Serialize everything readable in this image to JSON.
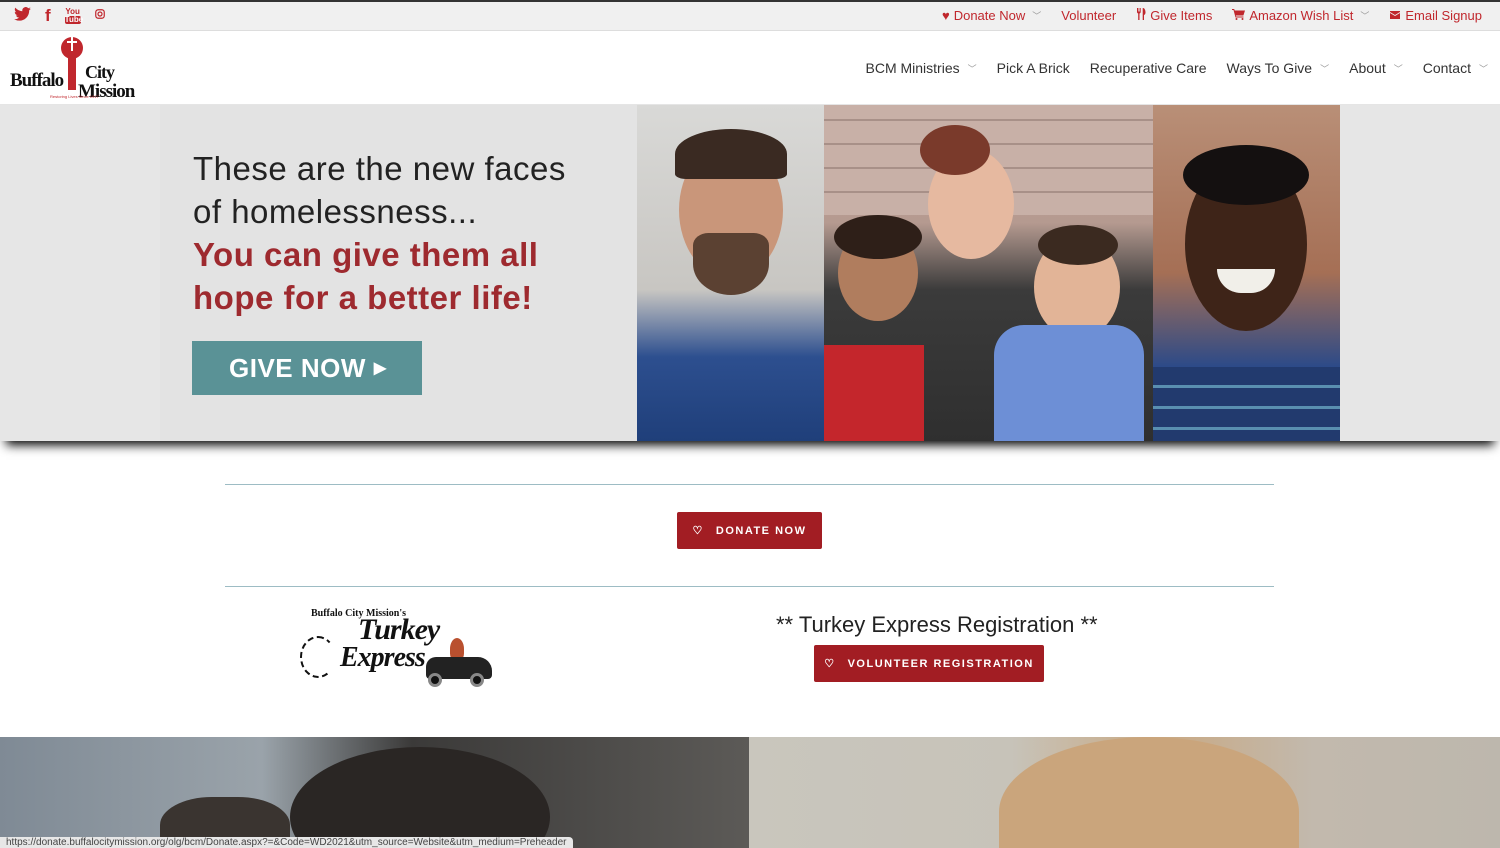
{
  "social": {
    "twitter": "twitter-icon",
    "facebook": "f",
    "youtube_top": "You",
    "youtube_bottom": "Tube",
    "instagram": "instagram-icon"
  },
  "topnav": [
    {
      "icon": "heart-icon",
      "glyph": "♥",
      "label": "Donate Now",
      "dropdown": true
    },
    {
      "icon": "",
      "glyph": "",
      "label": "Volunteer",
      "dropdown": false
    },
    {
      "icon": "utensils-icon",
      "glyph": "🍴",
      "label": "Give Items",
      "dropdown": false
    },
    {
      "icon": "cart-icon",
      "glyph": "🛒",
      "label": "Amazon Wish List",
      "dropdown": true
    },
    {
      "icon": "envelope-icon",
      "glyph": "✉",
      "label": "Email Signup",
      "dropdown": false
    }
  ],
  "logo": {
    "word1": "Buffalo",
    "word2": "City",
    "word3": "Mission",
    "tagline": "Restoring Lives Since 1917"
  },
  "mainnav": [
    {
      "label": "BCM Ministries",
      "dropdown": true
    },
    {
      "label": "Pick A Brick",
      "dropdown": false
    },
    {
      "label": "Recuperative Care",
      "dropdown": false
    },
    {
      "label": "Ways To Give",
      "dropdown": true
    },
    {
      "label": "About",
      "dropdown": true
    },
    {
      "label": "Contact",
      "dropdown": true
    }
  ],
  "hero": {
    "line1": "These are the new faces",
    "line2": "of homelessness...",
    "line3": "You can give them all",
    "line4": "hope for a better life!",
    "button": "GIVE NOW",
    "button_arrow": "▶"
  },
  "donate": {
    "label": "DONATE NOW",
    "heart": "♡"
  },
  "turkey": {
    "logo_top": "Buffalo City Mission's",
    "logo_word1": "Turkey",
    "logo_word2": "Express",
    "title": "** Turkey Express Registration **",
    "button": "VOLUNTEER REGISTRATION",
    "heart": "♡"
  },
  "status_url": "https://donate.buffalocitymission.org/olg/bcm/Donate.aspx?=&Code=WD2021&utm_source=Website&utm_medium=Preheader",
  "colors": {
    "brand_red": "#c0272d",
    "button_red": "#a21d23",
    "give_teal": "#5a9296",
    "hero_red_text": "#9e2a2f"
  }
}
